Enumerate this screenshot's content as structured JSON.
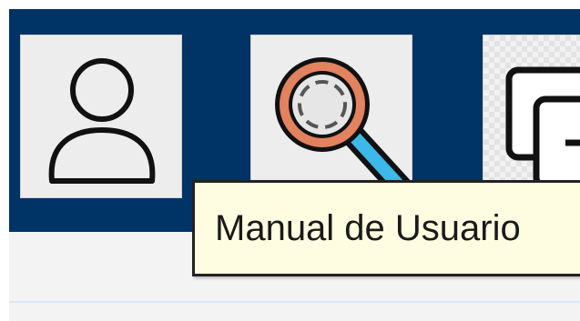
{
  "toolbar": {
    "background_color": "#003366",
    "buttons": [
      {
        "icon": "user-icon"
      },
      {
        "icon": "magnifier-icon"
      },
      {
        "icon": "add-window-icon"
      }
    ]
  },
  "tooltip": {
    "text": "Manual de Usuario",
    "background_color": "#fffde1"
  }
}
